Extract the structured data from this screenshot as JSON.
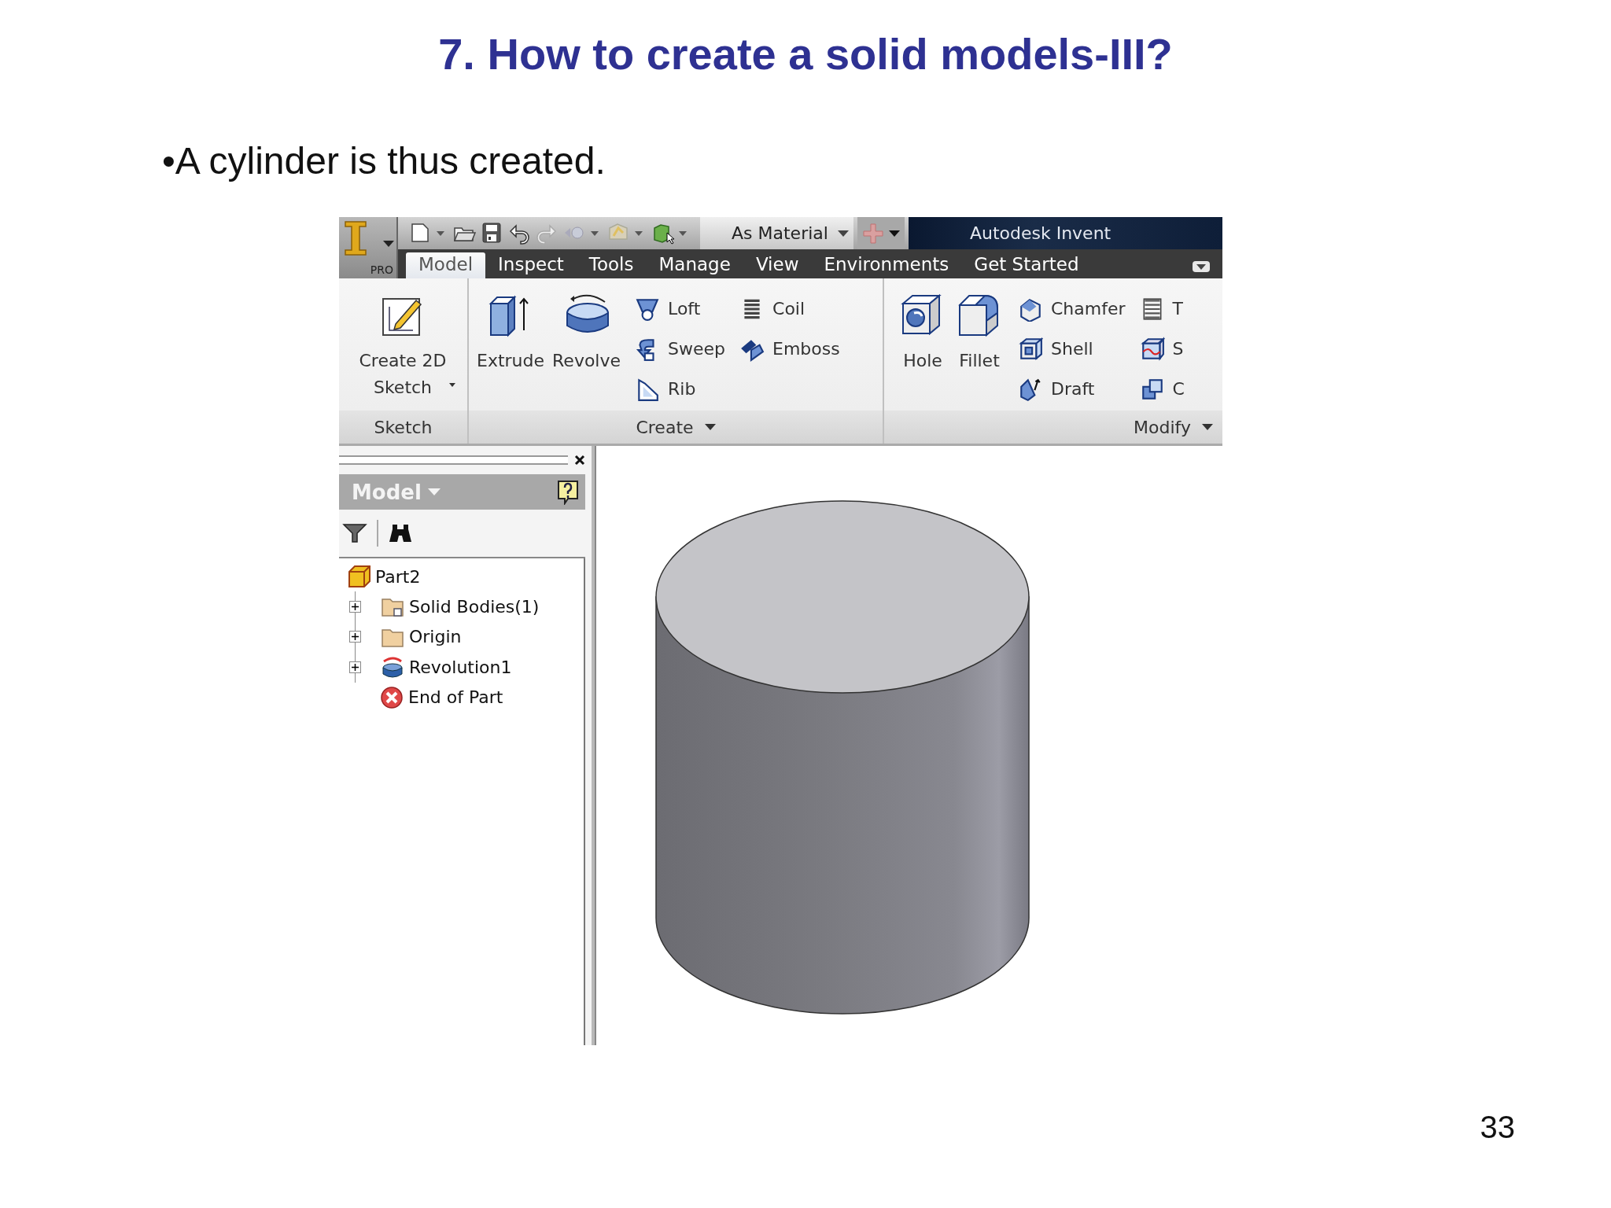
{
  "slide": {
    "title": "7. How to create a solid models-III?",
    "bullet": "•A cylinder is thus created.",
    "page_number": "33"
  },
  "app": {
    "app_button": "PRO",
    "appearance": "As Material",
    "window_title": "Autodesk Invent",
    "tabs": [
      {
        "label": "Model",
        "selected": true
      },
      {
        "label": "Inspect",
        "selected": false
      },
      {
        "label": "Tools",
        "selected": false
      },
      {
        "label": "Manage",
        "selected": false
      },
      {
        "label": "View",
        "selected": false
      },
      {
        "label": "Environments",
        "selected": false
      },
      {
        "label": "Get Started",
        "selected": false
      }
    ],
    "panels": [
      {
        "label": "Sketch",
        "menu": false,
        "groups": [
          {
            "kind": "large",
            "tools": [
              {
                "label": "Create 2D Sketch",
                "menu": true
              }
            ]
          }
        ]
      },
      {
        "label": "Create",
        "menu": true,
        "groups": [
          {
            "kind": "large",
            "tools": [
              {
                "label": "Extrude",
                "menu": false
              },
              {
                "label": "Revolve",
                "menu": false
              }
            ]
          },
          {
            "kind": "stack",
            "tools": [
              {
                "label": "Loft"
              },
              {
                "label": "Sweep"
              },
              {
                "label": "Rib"
              }
            ]
          },
          {
            "kind": "stack",
            "tools": [
              {
                "label": "Coil"
              },
              {
                "label": "Emboss"
              }
            ]
          }
        ]
      },
      {
        "label": "Modify",
        "menu": true,
        "groups": [
          {
            "kind": "large",
            "tools": [
              {
                "label": "Hole",
                "menu": false
              },
              {
                "label": "Fillet",
                "menu": false
              }
            ]
          },
          {
            "kind": "stack",
            "tools": [
              {
                "label": "Chamfer"
              },
              {
                "label": "Shell"
              },
              {
                "label": "Draft"
              }
            ]
          },
          {
            "kind": "stack",
            "tools": [
              {
                "label": "T"
              },
              {
                "label": "S"
              },
              {
                "label": "C"
              }
            ]
          }
        ]
      }
    ],
    "browser": {
      "title": "Model",
      "tree": {
        "label": "Part2",
        "children": [
          {
            "label": "Solid Bodies(1)",
            "kind": "collapsed"
          },
          {
            "label": "Origin",
            "kind": "collapsed"
          },
          {
            "label": "Revolution1",
            "kind": "collapsed"
          },
          {
            "label": "End of Part",
            "kind": "leaf"
          }
        ]
      }
    }
  }
}
